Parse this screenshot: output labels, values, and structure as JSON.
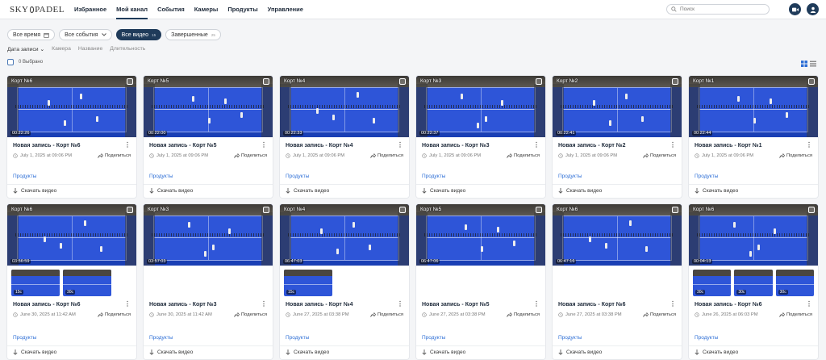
{
  "logo": {
    "left": "SKY",
    "right": "PADEL"
  },
  "nav": [
    {
      "label": "Избранное",
      "active": false
    },
    {
      "label": "Мой канал",
      "active": true
    },
    {
      "label": "События",
      "active": false
    },
    {
      "label": "Камеры",
      "active": false
    },
    {
      "label": "Продукты",
      "active": false
    },
    {
      "label": "Управление",
      "active": false
    }
  ],
  "search": {
    "placeholder": "Поиск"
  },
  "filters": {
    "time": "Все время",
    "events": "Все события",
    "videos": "Все видео",
    "videos_count": "15",
    "completed": "Завершенные",
    "completed_count": "25"
  },
  "sort": {
    "date": "Дата записи",
    "camera": "Камера",
    "name": "Название",
    "duration": "Длительность"
  },
  "selected": "0 Выбрано",
  "common": {
    "products": "Продукты",
    "download": "Скачать видео",
    "share": "Поделиться"
  },
  "cards": [
    {
      "court": "Корт №6",
      "duration": "00:22:26",
      "title": "Новая запись - Корт №6",
      "date": "July 1, 2025 at 09:06 PM",
      "minis": []
    },
    {
      "court": "Корт №5",
      "duration": "00:22:00",
      "title": "Новая запись - Корт №5",
      "date": "July 1, 2025 at 09:06 PM",
      "minis": []
    },
    {
      "court": "Корт №4",
      "duration": "00:22:33",
      "title": "Новая запись - Корт №4",
      "date": "July 1, 2025 at 09:06 PM",
      "minis": []
    },
    {
      "court": "Корт №3",
      "duration": "00:22:37",
      "title": "Новая запись - Корт №3",
      "date": "July 1, 2025 at 09:06 PM",
      "minis": []
    },
    {
      "court": "Корт №2",
      "duration": "00:22:41",
      "title": "Новая запись - Корт №2",
      "date": "July 1, 2025 at 09:06 PM",
      "minis": []
    },
    {
      "court": "Корт №1",
      "duration": "00:22:44",
      "title": "Новая запись - Корт №1",
      "date": "July 1, 2025 at 09:06 PM",
      "minis": []
    },
    {
      "court": "Корт №6",
      "duration": "03:56:59",
      "title": "Новая запись - Корт №6",
      "date": "June 30, 2025 at 11:42 AM",
      "minis": [
        "15с",
        "30с"
      ]
    },
    {
      "court": "Корт №3",
      "duration": "03:57:03",
      "title": "Новая запись - Корт №3",
      "date": "June 30, 2025 at 11:42 AM",
      "minis": []
    },
    {
      "court": "Корт №4",
      "duration": "06:47:03",
      "title": "Новая запись - Корт №4",
      "date": "June 27, 2025 at 03:38 PM",
      "minis": [
        "15с"
      ]
    },
    {
      "court": "Корт №5",
      "duration": "06:47:06",
      "title": "Новая запись - Корт №5",
      "date": "June 27, 2025 at 03:38 PM",
      "minis": []
    },
    {
      "court": "Корт №6",
      "duration": "06:47:16",
      "title": "Новая запись - Корт №6",
      "date": "June 27, 2025 at 03:38 PM",
      "minis": []
    },
    {
      "court": "Корт №6",
      "duration": "00:04:13",
      "title": "Новая запись - Корт №6",
      "date": "June 26, 2025 at 06:03 PM",
      "minis": [
        "30с",
        "30с",
        "30с"
      ]
    }
  ]
}
